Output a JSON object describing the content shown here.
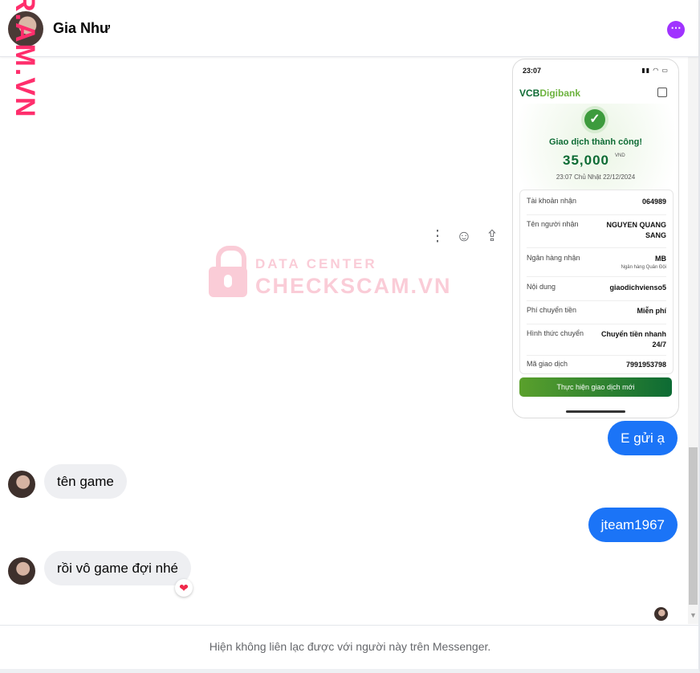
{
  "header": {
    "name": "Gia Như",
    "more_icon": "ellipsis-icon"
  },
  "watermark": {
    "side": "R.AM.VN",
    "top": "DATA CENTER",
    "main": "CHECKSCAM.VN",
    "icon": "lock-icon"
  },
  "receipt": {
    "status_time": "23:07",
    "logo_prefix": "VCB",
    "logo_suffix": "Digibank",
    "success": "Giao dịch thành công!",
    "amount": "35,000",
    "currency": "VND",
    "datetime": "23:07 Chủ Nhật 22/12/2024",
    "rows": [
      {
        "label": "Tài khoản nhận",
        "value": "064989"
      },
      {
        "label": "Tên người nhận",
        "value": "NGUYEN QUANG SANG"
      },
      {
        "label": "Ngân hàng nhận",
        "value": "MB",
        "sub": "Ngân hàng Quân Đội"
      },
      {
        "label": "Nội dung",
        "value": "giaodichvienso5"
      },
      {
        "label": "Phí chuyển tiền",
        "value": "Miễn phí"
      },
      {
        "label": "Hình thức chuyển",
        "value": "Chuyển tiền nhanh 24/7"
      },
      {
        "label": "Mã giao dịch",
        "value": "7991953798"
      }
    ],
    "button": "Thực hiện giao dịch mới"
  },
  "message_actions": {
    "more": "more-vertical-icon",
    "react": "smile-icon",
    "share": "share-icon"
  },
  "messages": [
    {
      "side": "out",
      "text": "E gửi ạ"
    },
    {
      "side": "in",
      "text": "tên game"
    },
    {
      "side": "out",
      "text": "jteam1967"
    },
    {
      "side": "in",
      "text": "rồi vô game đợi nhé",
      "reaction": "❤"
    }
  ],
  "footer": {
    "notice": "Hiện không liên lạc được với người này trên Messenger."
  }
}
